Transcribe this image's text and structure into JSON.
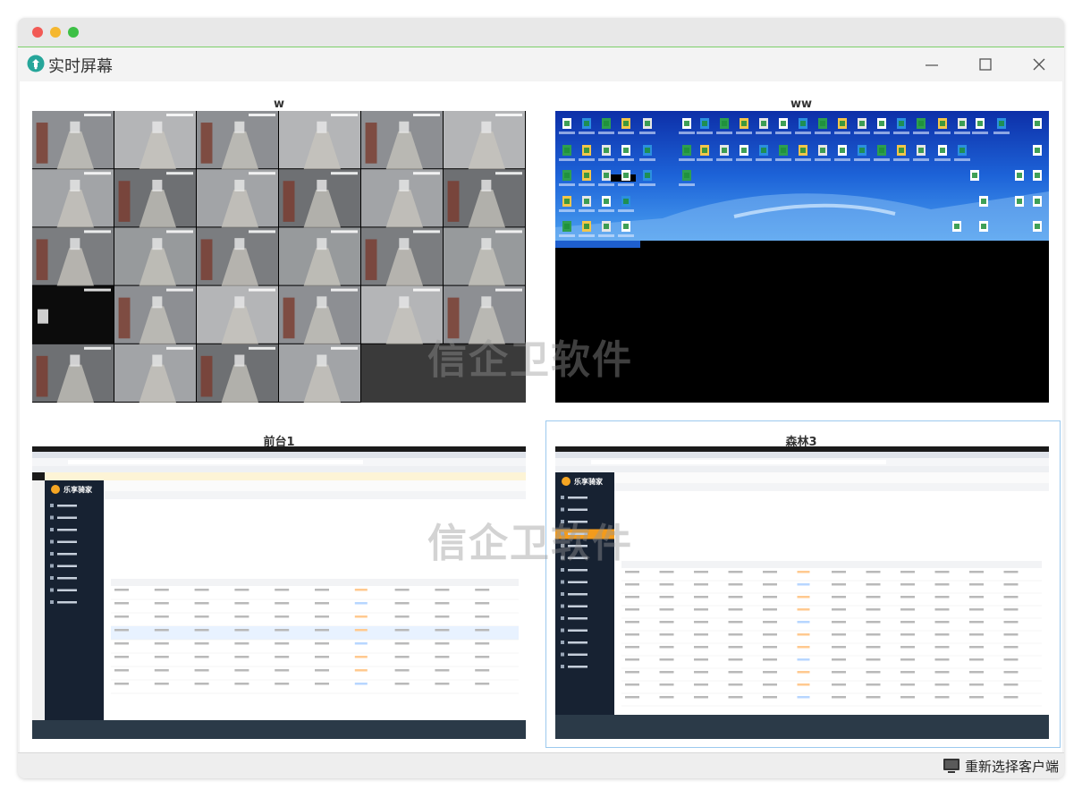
{
  "window": {
    "title": "实时屏幕",
    "controls": {
      "minimize": "minimize",
      "maximize": "maximize",
      "close": "close"
    }
  },
  "screens": [
    {
      "label": "w",
      "kind": "cctv-grid"
    },
    {
      "label": "ww",
      "kind": "desktop-icons"
    },
    {
      "label": "前台1",
      "kind": "admin-browser"
    },
    {
      "label": "森林3",
      "kind": "admin-browser",
      "selected": true
    }
  ],
  "watermark": "信企卫软件",
  "admin_app": {
    "logo": "乐享骑家"
  },
  "footer": {
    "reselect_label": "重新选择客户端"
  },
  "colors": {
    "accent_green": "#7ccf6a",
    "selected_border": "#9cc9ee",
    "app_icon": "#26a69a"
  }
}
